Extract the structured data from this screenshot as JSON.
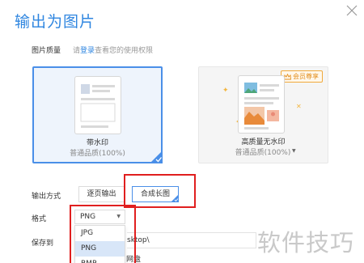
{
  "dialog": {
    "title": "输出为图片"
  },
  "quality": {
    "label": "图片质量",
    "hint_prefix": "请",
    "hint_link": "登录",
    "hint_suffix": "查看您的使用权限"
  },
  "cards": [
    {
      "name": "带水印",
      "sub": "普通品质(100%)",
      "selected": true
    },
    {
      "name": "高质量无水印",
      "sub": "普通品质(100%)",
      "badge": "会员尊享"
    }
  ],
  "output_mode": {
    "label": "输出方式",
    "options": [
      "逐页输出",
      "合成长图"
    ],
    "selected": "合成长图"
  },
  "format": {
    "label": "格式",
    "value": "PNG",
    "options": [
      "JPG",
      "PNG",
      "BMP"
    ],
    "highlighted": "PNG"
  },
  "save": {
    "label": "保存到",
    "path": "sktop\\",
    "netdisk_text": "网盘"
  },
  "watermark": {
    "text": "软件技巧"
  },
  "colors": {
    "accent": "#2f86e0",
    "annotation": "#e01f1f",
    "vip": "#f0a93c"
  }
}
